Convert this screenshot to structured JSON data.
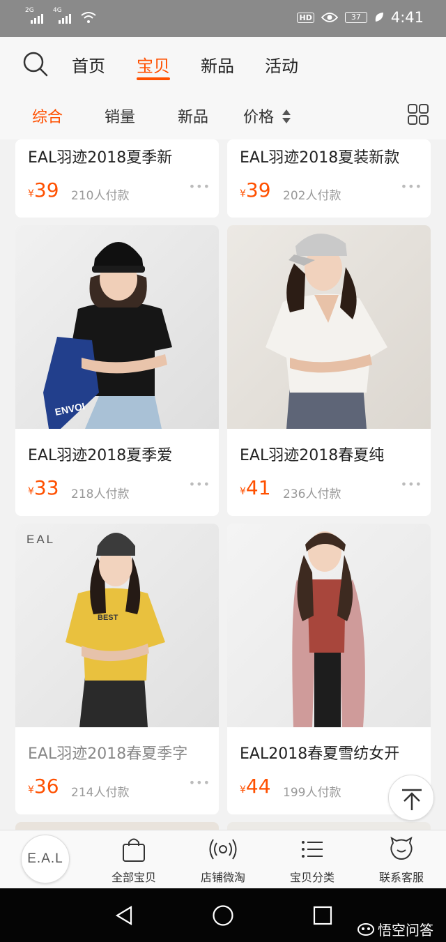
{
  "status_bar": {
    "net1": "2G",
    "net2": "4G",
    "hd": "HD",
    "battery": "37",
    "time": "4:41"
  },
  "top_nav": {
    "tabs": [
      "首页",
      "宝贝",
      "新品",
      "活动"
    ],
    "active": "宝贝"
  },
  "sort_bar": {
    "items": [
      "综合",
      "销量",
      "新品",
      "价格"
    ],
    "active": "综合"
  },
  "products": [
    {
      "title": "EAL羽迹2018夏季新",
      "currency": "¥",
      "price": "39",
      "sold": "210人付款"
    },
    {
      "title": "EAL羽迹2018夏装新款",
      "currency": "¥",
      "price": "39",
      "sold": "202人付款"
    },
    {
      "title": "EAL羽迹2018夏季爱",
      "currency": "¥",
      "price": "33",
      "sold": "218人付款"
    },
    {
      "title": "EAL羽迹2018春夏纯",
      "currency": "¥",
      "price": "41",
      "sold": "236人付款"
    },
    {
      "title": "EAL羽迹2018春夏季字",
      "currency": "¥",
      "price": "36",
      "sold": "214人付款",
      "photo_brand": "EAL",
      "bag_text": "ENVOI",
      "shirt_text": "BEST"
    },
    {
      "title": "EAL2018春夏雪纺女开",
      "currency": "¥",
      "price": "44",
      "sold": "199人付款"
    }
  ],
  "bottom_bar": {
    "logo": "E.A.L",
    "items": [
      "全部宝贝",
      "店铺微淘",
      "宝贝分类",
      "联系客服"
    ]
  },
  "watermark": "悟空问答",
  "more_glyph": "•••",
  "colors": {
    "accent": "#ff5000",
    "status_bar": "#8a8a8a",
    "nav_bar": "#050505"
  }
}
